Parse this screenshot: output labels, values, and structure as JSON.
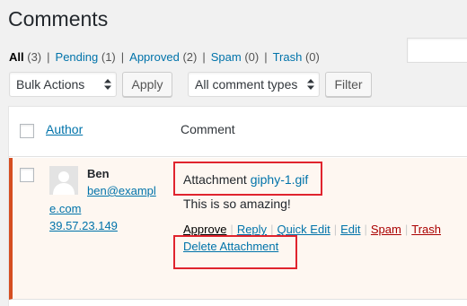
{
  "page": {
    "title": "Comments"
  },
  "filters": {
    "all_label": "All",
    "all_count": "(3)",
    "pending_label": "Pending",
    "pending_count": "(1)",
    "approved_label": "Approved",
    "approved_count": "(2)",
    "spam_label": "Spam",
    "spam_count": "(0)",
    "trash_label": "Trash",
    "trash_count": "(0)",
    "separator": "|"
  },
  "toolbar": {
    "bulk_actions": "Bulk Actions",
    "apply": "Apply",
    "comment_types": "All comment types",
    "filter": "Filter"
  },
  "table": {
    "headers": {
      "author": "Author",
      "comment": "Comment"
    },
    "row": {
      "author_name": "Ben",
      "author_email_line1": "ben@exampl",
      "author_email_line2": "e.com",
      "author_ip": "39.57.23.149",
      "attachment_label": "Attachment",
      "attachment_file": "giphy-1.gif",
      "comment_text": "This is so amazing!",
      "actions": {
        "approve": "Approve",
        "reply": "Reply",
        "quick_edit": "Quick Edit",
        "edit": "Edit",
        "spam": "Spam",
        "trash": "Trash",
        "delete_attachment": "Delete Attachment",
        "separator": "|"
      }
    }
  },
  "colors": {
    "link": "#0073aa",
    "danger": "#a00",
    "unapproved_border": "#d54e21",
    "unapproved_bg": "#fef7f1",
    "highlight": "#e0242e"
  }
}
